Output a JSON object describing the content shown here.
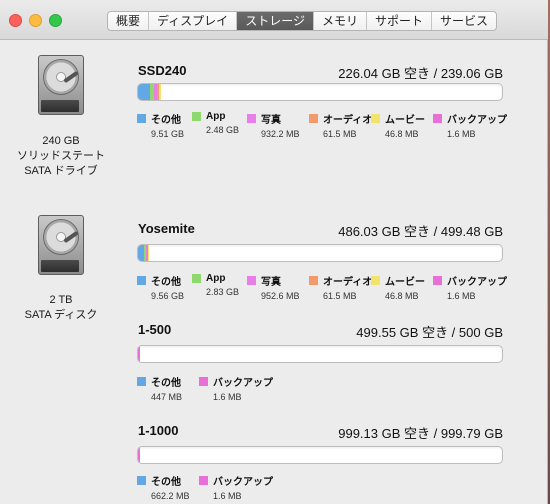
{
  "window": {
    "tabs": [
      {
        "label": "概要"
      },
      {
        "label": "ディスプレイ"
      },
      {
        "label": "ストレージ"
      },
      {
        "label": "メモリ"
      },
      {
        "label": "サポート"
      },
      {
        "label": "サービス"
      }
    ],
    "active_tab": "ストレージ"
  },
  "disks": [
    {
      "label_line1": "240 GB",
      "label_line2": "ソリッドステート",
      "label_line3": "SATA ドライブ"
    },
    {
      "label_line1": "2 TB",
      "label_line2": "SATA ディスク"
    }
  ],
  "volumes": [
    {
      "name": "SSD240",
      "free_text": "226.04 GB 空き / 239.06 GB",
      "legend": [
        {
          "name": "その他",
          "size": "9.51 GB",
          "color": "#62a8e4"
        },
        {
          "name": "App",
          "size": "2.48 GB",
          "color": "#8ed86e"
        },
        {
          "name": "写真",
          "size": "932.2 MB",
          "color": "#e87ee8"
        },
        {
          "name": "オーディオ",
          "size": "61.5 MB",
          "color": "#f29a6c"
        },
        {
          "name": "ムービー",
          "size": "46.8 MB",
          "color": "#f2e46a"
        },
        {
          "name": "バックアップ",
          "size": "1.6 MB",
          "color": "#e86fd6"
        }
      ]
    },
    {
      "name": "Yosemite",
      "free_text": "486.03 GB 空き / 499.48 GB",
      "legend": [
        {
          "name": "その他",
          "size": "9.56 GB",
          "color": "#62a8e4"
        },
        {
          "name": "App",
          "size": "2.83 GB",
          "color": "#8ed86e"
        },
        {
          "name": "写真",
          "size": "952.6 MB",
          "color": "#e87ee8"
        },
        {
          "name": "オーディオ",
          "size": "61.5 MB",
          "color": "#f29a6c"
        },
        {
          "name": "ムービー",
          "size": "46.8 MB",
          "color": "#f2e46a"
        },
        {
          "name": "バックアップ",
          "size": "1.6 MB",
          "color": "#e86fd6"
        }
      ]
    },
    {
      "name": "1-500",
      "free_text": "499.55 GB 空き / 500 GB",
      "legend": [
        {
          "name": "その他",
          "size": "447 MB",
          "color": "#62a8e4"
        },
        {
          "name": "バックアップ",
          "size": "1.6 MB",
          "color": "#e86fd6"
        }
      ]
    },
    {
      "name": "1-1000",
      "free_text": "999.13 GB 空き / 999.79 GB",
      "legend": [
        {
          "name": "その他",
          "size": "662.2 MB",
          "color": "#62a8e4"
        },
        {
          "name": "バックアップ",
          "size": "1.6 MB",
          "color": "#e86fd6"
        }
      ]
    }
  ]
}
